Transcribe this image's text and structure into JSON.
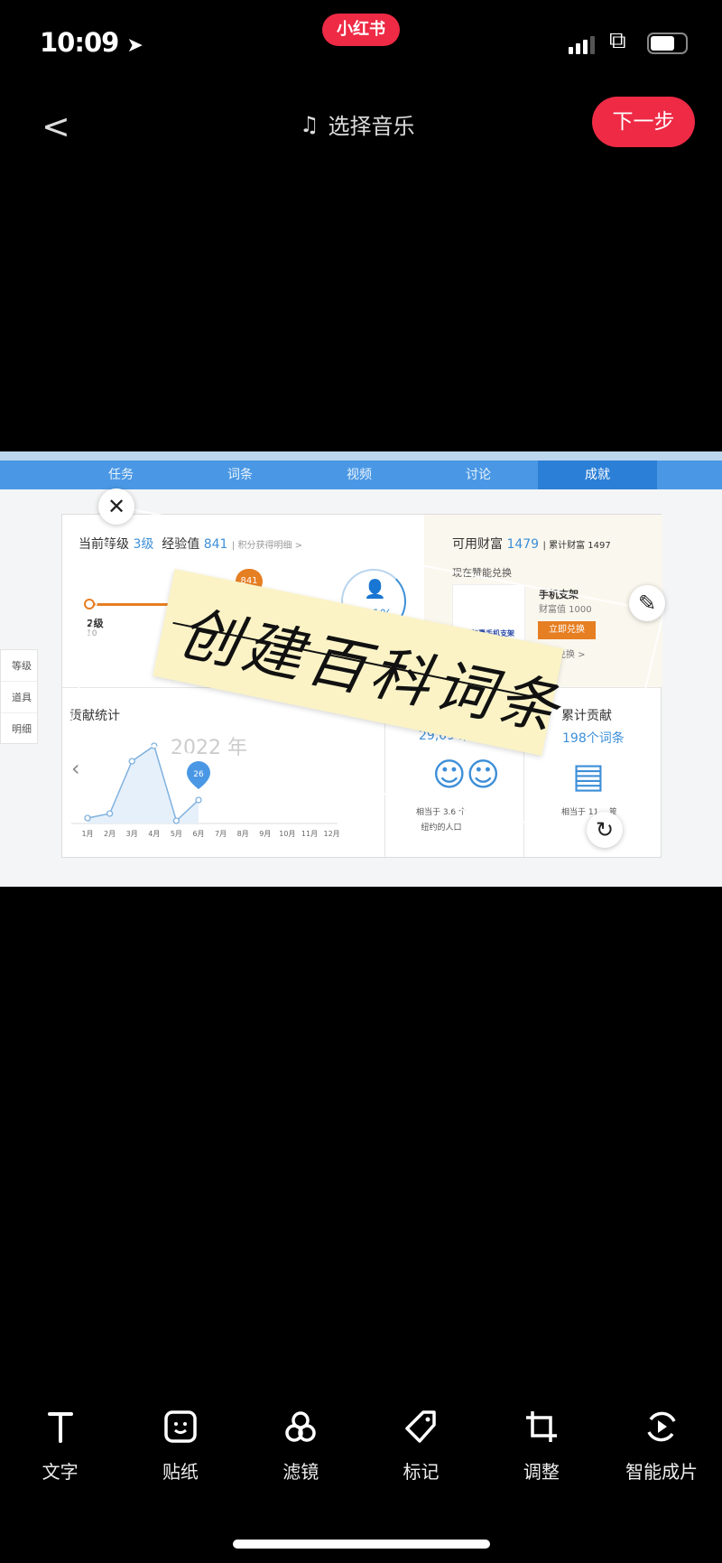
{
  "status_bar": {
    "time": "10:09",
    "app_badge": "小红书"
  },
  "header": {
    "back_icon": "chevron-left",
    "music_label": "选择音乐",
    "next_label": "下一步",
    "accent": "#ee2a45"
  },
  "photo": {
    "tabs": [
      {
        "label": "任务"
      },
      {
        "label": "词条"
      },
      {
        "label": "视频"
      },
      {
        "label": "讨论"
      },
      {
        "label": "成就",
        "active": true
      }
    ],
    "sidebar": [
      "等级",
      "道具",
      "明细"
    ],
    "level": {
      "label": "当前等级",
      "level": "3级",
      "exp_label": "经验值",
      "exp": "841",
      "detail_link": "| 积分获得明细 >",
      "marker": "841",
      "prev_level": "2级",
      "prev_sub": "10",
      "percent": "43.1%"
    },
    "wealth": {
      "label": "可用财富",
      "value": "1479",
      "total": "| 累计财富 1497",
      "exchange_title": "现在赞能兑换",
      "product_img_text": "定制气囊手机支架",
      "product_name": "手机支架",
      "product_price": "财富值 1000",
      "redeem_button": "立即兑换",
      "more": "更多兑换 >"
    },
    "contrib": {
      "title": "贡献统计",
      "year": "2022 年",
      "months": [
        "1月",
        "2月",
        "3月",
        "4月",
        "5月",
        "6月",
        "7月",
        "8月",
        "9月",
        "10月",
        "11月",
        "12月"
      ],
      "values": [
        6,
        11,
        69,
        86,
        3,
        26
      ],
      "marker": "26"
    },
    "views": {
      "value": "29,094,525",
      "line1": "相当于 3.6 个",
      "line2": "纽约的人口"
    },
    "total": {
      "title": "累计贡献",
      "value": "198个词条",
      "line1": "相当于 11… 篇"
    },
    "sticker_text": "创建百科词条"
  },
  "toolbar": [
    {
      "label": "文字",
      "icon": "text"
    },
    {
      "label": "贴纸",
      "icon": "sticker"
    },
    {
      "label": "滤镜",
      "icon": "filter"
    },
    {
      "label": "标记",
      "icon": "tag"
    },
    {
      "label": "调整",
      "icon": "crop"
    },
    {
      "label": "智能成片",
      "icon": "smart-video"
    }
  ]
}
